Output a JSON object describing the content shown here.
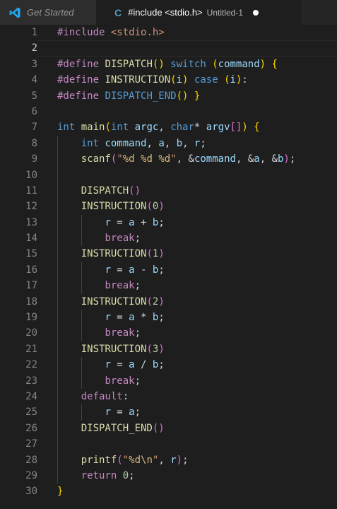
{
  "tabs": [
    {
      "label": "Get Started",
      "active": false,
      "icon": "vscode-icon"
    },
    {
      "label": "#include <stdio.h>",
      "sub": "Untitled-1",
      "active": true,
      "icon": "c-language-icon",
      "dirty": true
    }
  ],
  "colors": {
    "keyword": "#569cd6",
    "preprocessor": "#c586c0",
    "function": "#dcdcaa",
    "variable": "#9cdcfe",
    "string": "#ce9178",
    "number": "#b5cea8",
    "bracket1": "#ffd700",
    "bracket2": "#da70d6",
    "bracket3": "#179fff"
  },
  "editor": {
    "active_line": 2,
    "lines": [
      [
        [
          "pp",
          "#include"
        ],
        [
          "txt",
          " "
        ],
        [
          "str",
          "<stdio.h>"
        ]
      ],
      [],
      [
        [
          "pp",
          "#define"
        ],
        [
          "txt",
          " "
        ],
        [
          "fn",
          "DISPATCH"
        ],
        [
          "br1",
          "()"
        ],
        [
          "txt",
          " "
        ],
        [
          "kw",
          "switch"
        ],
        [
          "txt",
          " "
        ],
        [
          "br1",
          "("
        ],
        [
          "var",
          "command"
        ],
        [
          "br1",
          ")"
        ],
        [
          "txt",
          " "
        ],
        [
          "br1",
          "{"
        ]
      ],
      [
        [
          "pp",
          "#define"
        ],
        [
          "txt",
          " "
        ],
        [
          "fn",
          "INSTRUCTION"
        ],
        [
          "br1",
          "("
        ],
        [
          "var",
          "i"
        ],
        [
          "br1",
          ")"
        ],
        [
          "txt",
          " "
        ],
        [
          "kw",
          "case"
        ],
        [
          "txt",
          " "
        ],
        [
          "br1",
          "("
        ],
        [
          "var",
          "i"
        ],
        [
          "br1",
          ")"
        ],
        [
          "txt",
          ":"
        ]
      ],
      [
        [
          "pp",
          "#define"
        ],
        [
          "txt",
          " "
        ],
        [
          "mac",
          "DISPATCH_END"
        ],
        [
          "br1",
          "()"
        ],
        [
          "txt",
          " "
        ],
        [
          "br1",
          "}"
        ]
      ],
      [],
      [
        [
          "kw",
          "int"
        ],
        [
          "txt",
          " "
        ],
        [
          "fn",
          "main"
        ],
        [
          "br1",
          "("
        ],
        [
          "kw",
          "int"
        ],
        [
          "txt",
          " "
        ],
        [
          "var",
          "argc"
        ],
        [
          "txt",
          ", "
        ],
        [
          "kw",
          "char"
        ],
        [
          "txt",
          "* "
        ],
        [
          "var",
          "argv"
        ],
        [
          "br2",
          "[]"
        ],
        [
          "br1",
          ")"
        ],
        [
          "txt",
          " "
        ],
        [
          "br1",
          "{"
        ]
      ],
      [
        [
          "txt",
          "    "
        ],
        [
          "kw",
          "int"
        ],
        [
          "txt",
          " "
        ],
        [
          "var",
          "command"
        ],
        [
          "txt",
          ", "
        ],
        [
          "var",
          "a"
        ],
        [
          "txt",
          ", "
        ],
        [
          "var",
          "b"
        ],
        [
          "txt",
          ", "
        ],
        [
          "var",
          "r"
        ],
        [
          "txt",
          ";"
        ]
      ],
      [
        [
          "txt",
          "    "
        ],
        [
          "fn",
          "scanf"
        ],
        [
          "br2",
          "("
        ],
        [
          "str",
          "\""
        ],
        [
          "esc",
          "%d"
        ],
        [
          "str",
          " "
        ],
        [
          "esc",
          "%d"
        ],
        [
          "str",
          " "
        ],
        [
          "esc",
          "%d"
        ],
        [
          "str",
          "\""
        ],
        [
          "txt",
          ", &"
        ],
        [
          "var",
          "command"
        ],
        [
          "txt",
          ", &"
        ],
        [
          "var",
          "a"
        ],
        [
          "txt",
          ", &"
        ],
        [
          "var",
          "b"
        ],
        [
          "br2",
          ")"
        ],
        [
          "txt",
          ";"
        ]
      ],
      [],
      [
        [
          "txt",
          "    "
        ],
        [
          "fn",
          "DISPATCH"
        ],
        [
          "br2",
          "()"
        ]
      ],
      [
        [
          "txt",
          "    "
        ],
        [
          "fn",
          "INSTRUCTION"
        ],
        [
          "br2",
          "("
        ],
        [
          "num",
          "0"
        ],
        [
          "br2",
          ")"
        ]
      ],
      [
        [
          "txt",
          "        "
        ],
        [
          "var",
          "r"
        ],
        [
          "txt",
          " = "
        ],
        [
          "var",
          "a"
        ],
        [
          "txt",
          " + "
        ],
        [
          "var",
          "b"
        ],
        [
          "txt",
          ";"
        ]
      ],
      [
        [
          "txt",
          "        "
        ],
        [
          "pp",
          "break"
        ],
        [
          "txt",
          ";"
        ]
      ],
      [
        [
          "txt",
          "    "
        ],
        [
          "fn",
          "INSTRUCTION"
        ],
        [
          "br2",
          "("
        ],
        [
          "num",
          "1"
        ],
        [
          "br2",
          ")"
        ]
      ],
      [
        [
          "txt",
          "        "
        ],
        [
          "var",
          "r"
        ],
        [
          "txt",
          " = "
        ],
        [
          "var",
          "a"
        ],
        [
          "txt",
          " - "
        ],
        [
          "var",
          "b"
        ],
        [
          "txt",
          ";"
        ]
      ],
      [
        [
          "txt",
          "        "
        ],
        [
          "pp",
          "break"
        ],
        [
          "txt",
          ";"
        ]
      ],
      [
        [
          "txt",
          "    "
        ],
        [
          "fn",
          "INSTRUCTION"
        ],
        [
          "br2",
          "("
        ],
        [
          "num",
          "2"
        ],
        [
          "br2",
          ")"
        ]
      ],
      [
        [
          "txt",
          "        "
        ],
        [
          "var",
          "r"
        ],
        [
          "txt",
          " = "
        ],
        [
          "var",
          "a"
        ],
        [
          "txt",
          " * "
        ],
        [
          "var",
          "b"
        ],
        [
          "txt",
          ";"
        ]
      ],
      [
        [
          "txt",
          "        "
        ],
        [
          "pp",
          "break"
        ],
        [
          "txt",
          ";"
        ]
      ],
      [
        [
          "txt",
          "    "
        ],
        [
          "fn",
          "INSTRUCTION"
        ],
        [
          "br2",
          "("
        ],
        [
          "num",
          "3"
        ],
        [
          "br2",
          ")"
        ]
      ],
      [
        [
          "txt",
          "        "
        ],
        [
          "var",
          "r"
        ],
        [
          "txt",
          " = "
        ],
        [
          "var",
          "a"
        ],
        [
          "txt",
          " / "
        ],
        [
          "var",
          "b"
        ],
        [
          "txt",
          ";"
        ]
      ],
      [
        [
          "txt",
          "        "
        ],
        [
          "pp",
          "break"
        ],
        [
          "txt",
          ";"
        ]
      ],
      [
        [
          "txt",
          "    "
        ],
        [
          "pp",
          "default"
        ],
        [
          "txt",
          ":"
        ]
      ],
      [
        [
          "txt",
          "        "
        ],
        [
          "var",
          "r"
        ],
        [
          "txt",
          " = "
        ],
        [
          "var",
          "a"
        ],
        [
          "txt",
          ";"
        ]
      ],
      [
        [
          "txt",
          "    "
        ],
        [
          "fn",
          "DISPATCH_END"
        ],
        [
          "br2",
          "()"
        ]
      ],
      [],
      [
        [
          "txt",
          "    "
        ],
        [
          "fn",
          "printf"
        ],
        [
          "br2",
          "("
        ],
        [
          "str",
          "\""
        ],
        [
          "esc",
          "%d"
        ],
        [
          "esc",
          "\\n"
        ],
        [
          "str",
          "\""
        ],
        [
          "txt",
          ", "
        ],
        [
          "var",
          "r"
        ],
        [
          "br2",
          ")"
        ],
        [
          "txt",
          ";"
        ]
      ],
      [
        [
          "txt",
          "    "
        ],
        [
          "pp",
          "return"
        ],
        [
          "txt",
          " "
        ],
        [
          "num",
          "0"
        ],
        [
          "txt",
          ";"
        ]
      ],
      [
        [
          "br1",
          "}"
        ]
      ]
    ]
  }
}
